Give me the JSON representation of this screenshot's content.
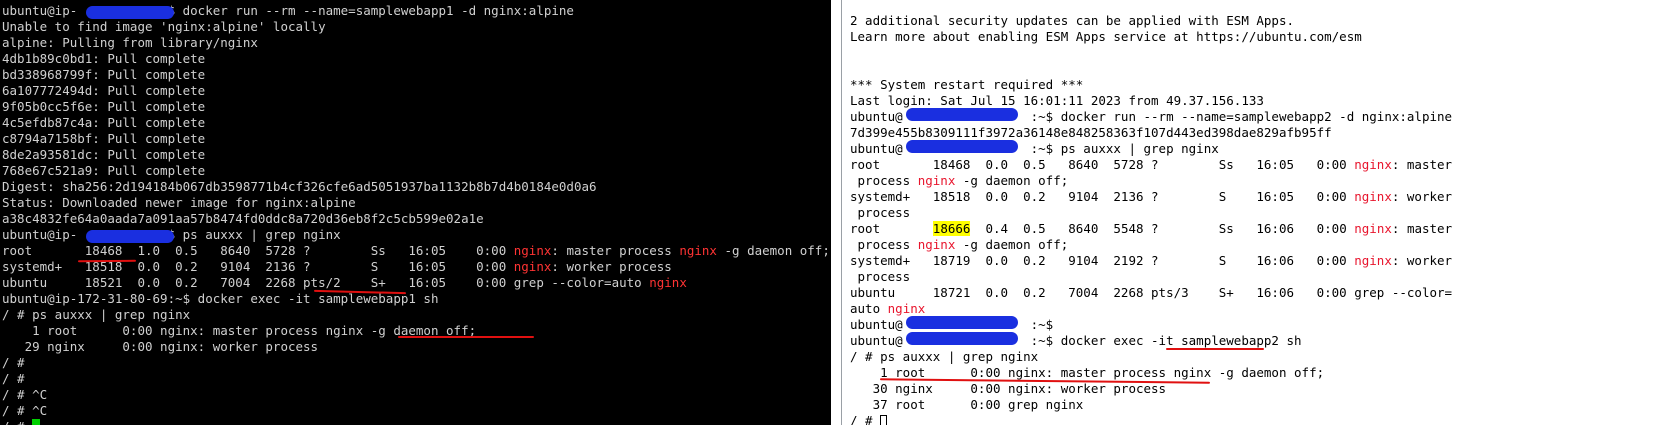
{
  "left_terminal": {
    "lines": [
      [
        {
          "t": "ubuntu@ip-          :~$ docker run --rm --name=samplewebapp1 -d nginx:alpine"
        }
      ],
      [
        {
          "t": "Unable to find image 'nginx:alpine' locally"
        }
      ],
      [
        {
          "t": "alpine: Pulling from library/nginx"
        }
      ],
      [
        {
          "t": "4db1b89c0bd1: Pull complete"
        }
      ],
      [
        {
          "t": "bd338968799f: Pull complete"
        }
      ],
      [
        {
          "t": "6a107772494d: Pull complete"
        }
      ],
      [
        {
          "t": "9f05b0cc5f6e: Pull complete"
        }
      ],
      [
        {
          "t": "4c5efdb87c4a: Pull complete"
        }
      ],
      [
        {
          "t": "c8794a7158bf: Pull complete"
        }
      ],
      [
        {
          "t": "8de2a93581dc: Pull complete"
        }
      ],
      [
        {
          "t": "768e67c521a9: Pull complete"
        }
      ],
      [
        {
          "t": "Digest: sha256:2d194184b067db3598771b4cf326cfe6ad5051937ba1132b8b7d4b0184e0d0a6"
        }
      ],
      [
        {
          "t": "Status: Downloaded newer image for nginx:alpine"
        }
      ],
      [
        {
          "t": "a38c4832fe64a0aada7a091aa57b8474fd0ddc8a720d36eb8f2c5cb599e02a1e"
        }
      ],
      [
        {
          "t": "ubuntu@ip-          :~$ ps auxxx | grep nginx"
        }
      ],
      [
        {
          "t": "root       18468  1.0  0.5   8640  5728 ?        Ss   16:05    0:00 "
        },
        {
          "t": "nginx",
          "c": "red"
        },
        {
          "t": ": master process "
        },
        {
          "t": "nginx",
          "c": "red"
        },
        {
          "t": " -g daemon off;"
        }
      ],
      [
        {
          "t": "systemd+   18518  0.0  0.2   9104  2136 ?        S    16:05    0:00 "
        },
        {
          "t": "nginx",
          "c": "red"
        },
        {
          "t": ": worker process"
        }
      ],
      [
        {
          "t": "ubuntu     18521  0.0  0.2   7004  2268 pts/2    S+   16:05    0:00 grep --color=auto "
        },
        {
          "t": "nginx",
          "c": "red"
        }
      ],
      [
        {
          "t": "ubuntu@ip-172-31-80-69:~$ docker exec -it samplewebapp1 sh"
        }
      ],
      [
        {
          "t": "/ # ps auxxx | grep nginx"
        }
      ],
      [
        {
          "t": "    1 root      0:00 nginx: master process nginx -g daemon off;"
        }
      ],
      [
        {
          "t": "   29 nginx     0:00 nginx: worker process"
        }
      ],
      [
        {
          "t": "/ #"
        }
      ],
      [
        {
          "t": "/ #"
        }
      ],
      [
        {
          "t": "/ # ^C"
        }
      ],
      [
        {
          "t": "/ # ^C"
        }
      ],
      [
        {
          "t": "/ # "
        },
        {
          "cursor": "green"
        }
      ]
    ]
  },
  "right_terminal": {
    "lines": [
      [
        {
          "t": "2 additional security updates can be applied with ESM Apps."
        }
      ],
      [
        {
          "t": "Learn more about enabling ESM Apps service at https://ubuntu.com/esm"
        }
      ],
      [
        {
          "t": ""
        }
      ],
      [
        {
          "t": ""
        }
      ],
      [
        {
          "t": "*** System restart required ***"
        }
      ],
      [
        {
          "t": "Last login: Sat Jul 15 16:01:11 2023 from 49.37.156.133"
        }
      ],
      [
        {
          "t": "ubuntu@                 :~$ docker run --rm --name=samplewebapp2 -d nginx:alpine"
        }
      ],
      [
        {
          "t": "7d399e455b8309111f3972a36148e848258363f107d443ed398dae829afb95ff"
        }
      ],
      [
        {
          "t": "ubuntu@                 :~$ ps auxxx | grep nginx"
        }
      ],
      [
        {
          "t": "root       18468  0.0  0.5   8640  5728 ?        Ss   16:05   0:00 "
        },
        {
          "t": "nginx",
          "c": "red"
        },
        {
          "t": ": master"
        }
      ],
      [
        {
          "t": " process "
        },
        {
          "t": "nginx",
          "c": "red"
        },
        {
          "t": " -g daemon off;"
        }
      ],
      [
        {
          "t": "systemd+   18518  0.0  0.2   9104  2136 ?        S    16:05   0:00 "
        },
        {
          "t": "nginx",
          "c": "red"
        },
        {
          "t": ": worker"
        }
      ],
      [
        {
          "t": " process"
        }
      ],
      [
        {
          "t": "root       "
        },
        {
          "t": "18666",
          "c": "hl"
        },
        {
          "t": "  0.4  0.5   8640  5548 ?        Ss   16:06   0:00 "
        },
        {
          "t": "nginx",
          "c": "red"
        },
        {
          "t": ": master"
        }
      ],
      [
        {
          "t": " process "
        },
        {
          "t": "nginx",
          "c": "red"
        },
        {
          "t": " -g daemon off;"
        }
      ],
      [
        {
          "t": "systemd+   18719  0.0  0.2   9104  2192 ?        S    16:06   0:00 "
        },
        {
          "t": "nginx",
          "c": "red"
        },
        {
          "t": ": worker"
        }
      ],
      [
        {
          "t": " process"
        }
      ],
      [
        {
          "t": "ubuntu     18721  0.0  0.2   7004  2268 pts/3    S+   16:06   0:00 grep --color="
        }
      ],
      [
        {
          "t": "auto "
        },
        {
          "t": "nginx",
          "c": "red"
        }
      ],
      [
        {
          "t": "ubuntu@                 :~$"
        }
      ],
      [
        {
          "t": "ubuntu@                 :~$ docker exec -it samplewebapp2 sh"
        }
      ],
      [
        {
          "t": "/ # ps auxxx | grep nginx"
        }
      ],
      [
        {
          "t": "    1 root      0:00 nginx: master process nginx -g daemon off;"
        }
      ],
      [
        {
          "t": "   30 nginx     0:00 nginx: worker process"
        }
      ],
      [
        {
          "t": "   37 root      0:00 grep nginx"
        }
      ],
      [
        {
          "t": "/ # "
        },
        {
          "cursor": "outline"
        }
      ]
    ]
  },
  "colors": {
    "left_bg": "#000000",
    "left_fg": "#d0d0d0",
    "right_bg": "#ffffff",
    "right_fg": "#000000",
    "match_red": "#ff3333",
    "highlight": "#ffff00",
    "redaction": "#1a2fe0",
    "underline": "#e01010",
    "cursor_green": "#00d000"
  }
}
